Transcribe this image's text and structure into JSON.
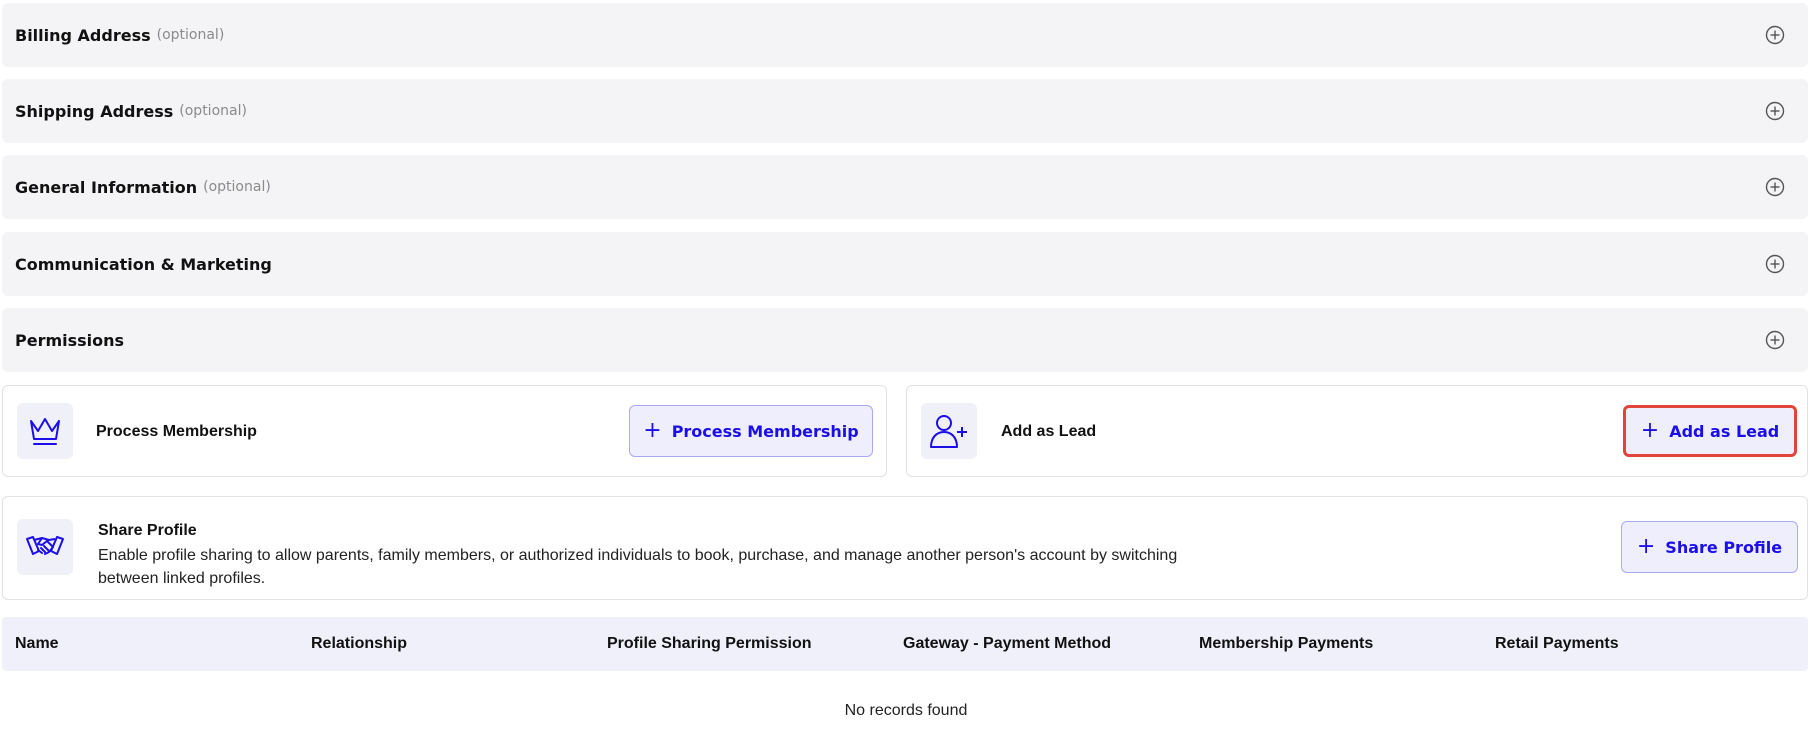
{
  "sections": [
    {
      "title": "Billing Address",
      "optional": "(optional)"
    },
    {
      "title": "Shipping Address",
      "optional": "(optional)"
    },
    {
      "title": "General Information",
      "optional": "(optional)"
    },
    {
      "title": "Communication & Marketing",
      "optional": ""
    },
    {
      "title": "Permissions",
      "optional": ""
    }
  ],
  "process_membership": {
    "label": "Process Membership",
    "button_label": "Process Membership",
    "icon": "crown-icon"
  },
  "add_as_lead": {
    "label": "Add as Lead",
    "button_label": "Add as Lead",
    "icon": "add-user-icon"
  },
  "share_profile": {
    "title": "Share Profile",
    "description": "Enable profile sharing to allow parents, family members, or authorized individuals to book, purchase, and manage another person's account by switching between linked profiles.",
    "button_label": "Share Profile",
    "icon": "handshake-icon"
  },
  "table": {
    "columns": [
      "Name",
      "Relationship",
      "Profile Sharing Permission",
      "Gateway - Payment Method",
      "Membership Payments",
      "Retail Payments"
    ],
    "empty_text": "No records found"
  },
  "colors": {
    "accent": "#1b0ee8",
    "focus_ring": "#e0443c",
    "section_bg": "#f4f4f6"
  }
}
